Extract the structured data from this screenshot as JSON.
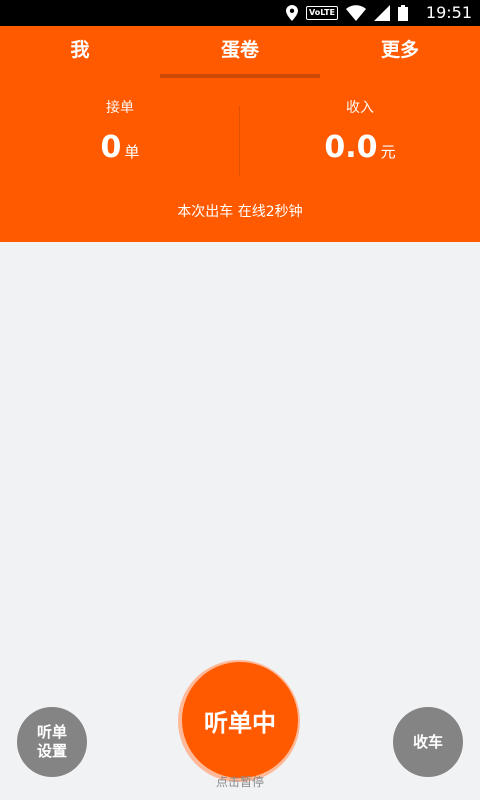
{
  "status_bar": {
    "time": "19:51",
    "volte_label": "VoLTE",
    "icons": [
      "location-icon",
      "volte-icon",
      "wifi-icon",
      "signal-icon",
      "battery-icon"
    ]
  },
  "tabs": [
    {
      "label": "我"
    },
    {
      "label": "蛋卷",
      "active": true
    },
    {
      "label": "更多"
    }
  ],
  "stats": {
    "orders": {
      "label": "接单",
      "value": "0",
      "unit": "单"
    },
    "income": {
      "label": "收入",
      "value": "0.0",
      "unit": "元"
    }
  },
  "online_text": "本次出车 在线2秒钟",
  "controls": {
    "settings_line1": "听单",
    "settings_line2": "设置",
    "listen_label": "听单中",
    "pause_hint": "点击暂停",
    "stop_label": "收车"
  },
  "colors": {
    "accent": "#ff5a00",
    "background": "#f1f2f4",
    "button_gray": "#848484"
  }
}
